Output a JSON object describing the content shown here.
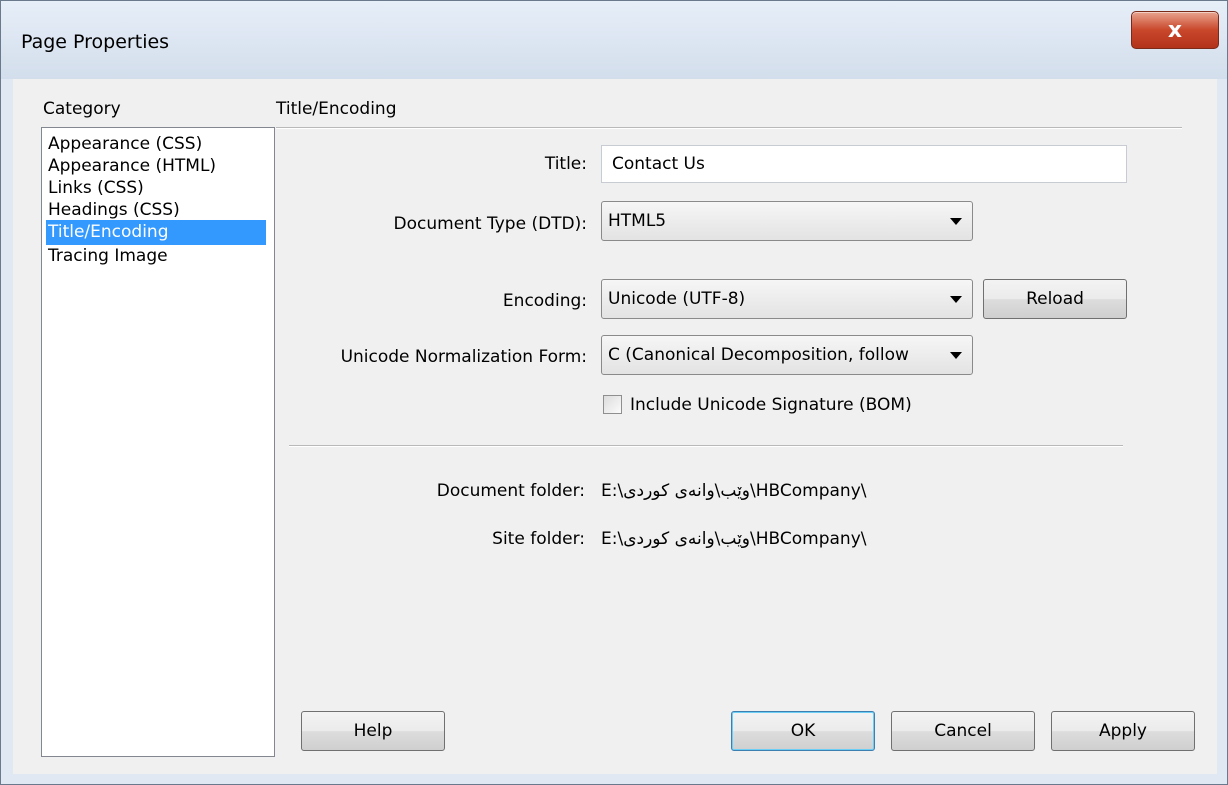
{
  "window": {
    "title": "Page Properties",
    "close_glyph": "x"
  },
  "category": {
    "label": "Category",
    "items": [
      {
        "label": "Appearance (CSS)"
      },
      {
        "label": "Appearance (HTML)"
      },
      {
        "label": "Links (CSS)"
      },
      {
        "label": "Headings (CSS)"
      },
      {
        "label": "Title/Encoding",
        "selected": true
      },
      {
        "label": "Tracing Image"
      }
    ]
  },
  "section": {
    "title": "Title/Encoding"
  },
  "form": {
    "title_label": "Title:",
    "title_value": "Contact Us",
    "doctype_label": "Document Type (DTD):",
    "doctype_value": "HTML5",
    "encoding_label": "Encoding:",
    "encoding_value": "Unicode (UTF-8)",
    "reload_label": "Reload",
    "normalization_label": "Unicode Normalization Form:",
    "normalization_value": "C (Canonical Decomposition, follow",
    "bom_label": "Include Unicode Signature (BOM)",
    "bom_checked": false
  },
  "info": {
    "document_folder_label": "Document folder:",
    "document_folder_value": "E:\\وێب\\وانەی کوردی\\HBCompany\\",
    "site_folder_label": "Site folder:",
    "site_folder_value": "E:\\وێب\\وانەی کوردی\\HBCompany\\"
  },
  "buttons": {
    "help": "Help",
    "ok": "OK",
    "cancel": "Cancel",
    "apply": "Apply"
  },
  "colors": {
    "selection": "#3399ff",
    "close_button": "#c9472b",
    "titlebar": "#dfe8f3"
  }
}
